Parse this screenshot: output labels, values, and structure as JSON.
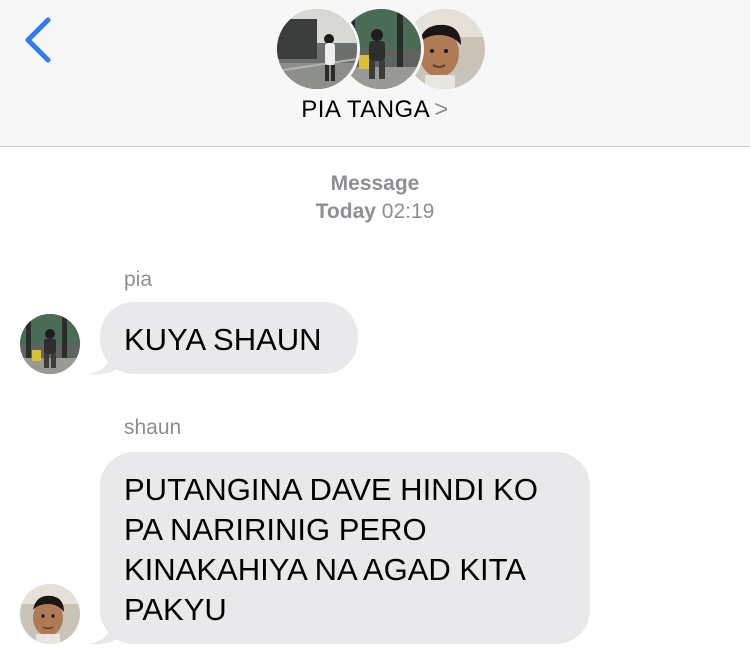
{
  "header": {
    "group_name": "PIA TANGA",
    "chevron": ">",
    "back_icon": "chevron-left-icon",
    "accent": "#2f7cf6"
  },
  "conversation_meta": {
    "service": "Message",
    "day": "Today",
    "time": "02:19"
  },
  "messages": [
    {
      "sender": "pia",
      "text": "KUYA SHAUN"
    },
    {
      "sender": "shaun",
      "text": "PUTANGINA DAVE HINDI KO PA NARIRINIG PERO KINAKAHIYA NA AGAD KITA PAKYU"
    }
  ],
  "colors": {
    "header_bg": "#f7f7f7",
    "bubble_incoming": "#e9e9eb",
    "secondary_text": "#8e8e93"
  }
}
